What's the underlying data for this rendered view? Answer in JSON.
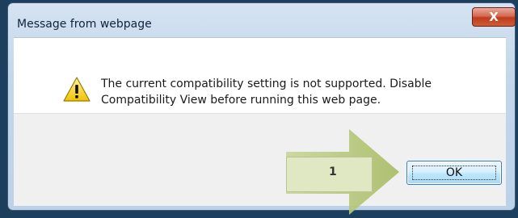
{
  "dialog": {
    "title": "Message from webpage",
    "close_label": "X",
    "message_line1": "The current compatibility setting is not supported. Disable",
    "message_line2": "Compatibility View before running this web page.",
    "ok_label": "OK",
    "icon": "warning-icon"
  },
  "annotation": {
    "step_number": "1",
    "arrow_color": "#b5c77a",
    "box_color": "#dfe8c2"
  }
}
